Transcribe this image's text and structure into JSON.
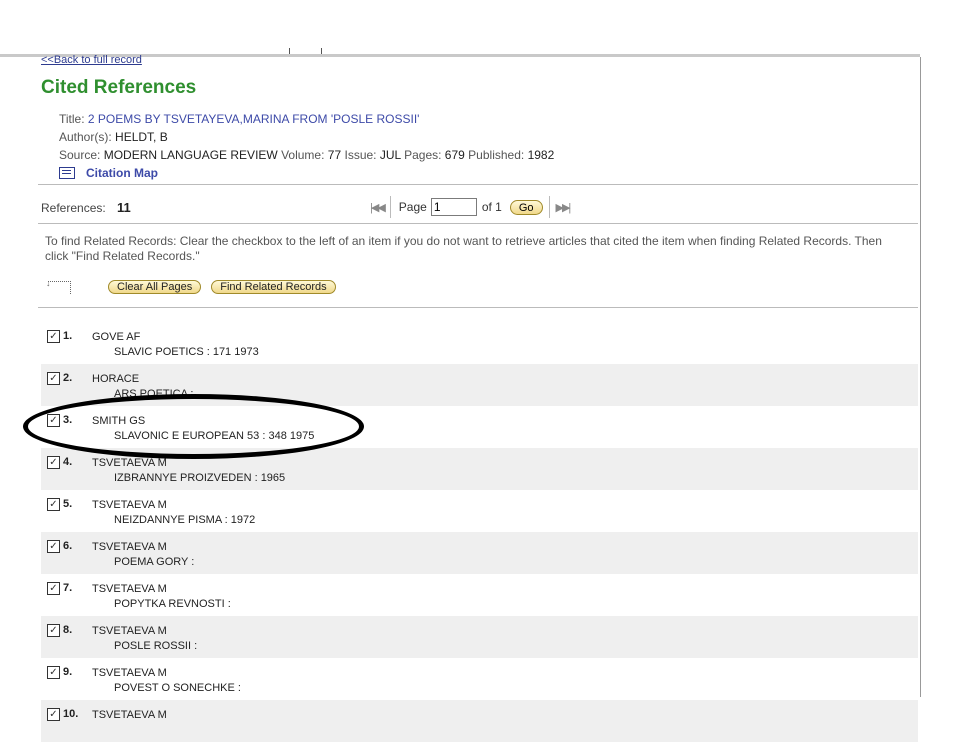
{
  "nav": {
    "back_label": "<<Back to full record"
  },
  "page": {
    "title": "Cited References"
  },
  "record": {
    "title_label": "Title:",
    "title_value": "2 POEMS BY TSVETAYEVA,MARINA FROM 'POSLE ROSSII'",
    "authors_label": "Author(s):",
    "authors_value": "HELDT, B",
    "source_label": "Source:",
    "source_value": "MODERN LANGUAGE REVIEW",
    "volume_label": "Volume:",
    "volume_value": "77",
    "issue_label": "Issue:",
    "issue_value": "JUL",
    "pages_label": "Pages:",
    "pages_value": "679",
    "published_label": "Published:",
    "published_value": "1982",
    "citation_map_label": "Citation Map"
  },
  "references": {
    "label": "References:",
    "count": "11"
  },
  "pager": {
    "page_label": "Page",
    "page_value": "1",
    "of_label": "of 1",
    "go_label": "Go"
  },
  "instructions": "To find Related Records: Clear the checkbox to the left of an item if you do not want to retrieve articles that cited the item when finding Related Records. Then click \"Find Related Records.\"",
  "buttons": {
    "clear_all": "Clear All Pages",
    "find_related": "Find Related Records"
  },
  "items": [
    {
      "num": "1.",
      "author": "GOVE AF",
      "work": "SLAVIC POETICS : 171 1973",
      "checked": true
    },
    {
      "num": "2.",
      "author": "HORACE",
      "work": "ARS POETICA :",
      "checked": true
    },
    {
      "num": "3.",
      "author": "SMITH GS",
      "work": "SLAVONIC E EUROPEAN 53 : 348 1975",
      "checked": true
    },
    {
      "num": "4.",
      "author": "TSVETAEVA M",
      "work": "IZBRANNYE PROIZVEDEN : 1965",
      "checked": true
    },
    {
      "num": "5.",
      "author": "TSVETAEVA M",
      "work": "NEIZDANNYE PISMA : 1972",
      "checked": true
    },
    {
      "num": "6.",
      "author": "TSVETAEVA M",
      "work": "POEMA GORY :",
      "checked": true
    },
    {
      "num": "7.",
      "author": "TSVETAEVA M",
      "work": "POPYTKA REVNOSTI :",
      "checked": true
    },
    {
      "num": "8.",
      "author": "TSVETAEVA M",
      "work": "POSLE ROSSII :",
      "checked": true
    },
    {
      "num": "9.",
      "author": "TSVETAEVA M",
      "work": "POVEST O SONECHKE :",
      "checked": true
    },
    {
      "num": "10.",
      "author": "TSVETAEVA M",
      "work": "",
      "checked": true
    }
  ]
}
